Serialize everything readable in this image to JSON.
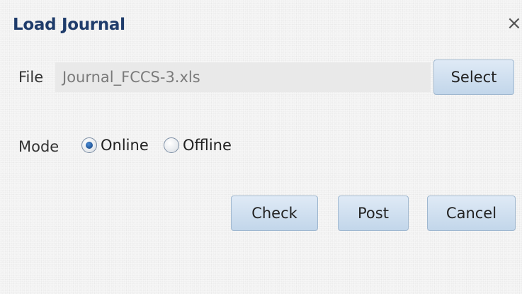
{
  "dialog": {
    "title": "Load Journal",
    "close_icon": "close-icon"
  },
  "file": {
    "label": "File",
    "value": "Journal_FCCS-3.xls",
    "select_label": "Select"
  },
  "mode": {
    "label": "Mode",
    "options": [
      {
        "label": "Online",
        "selected": true
      },
      {
        "label": "Offline",
        "selected": false
      }
    ]
  },
  "actions": {
    "check_label": "Check",
    "post_label": "Post",
    "cancel_label": "Cancel"
  }
}
